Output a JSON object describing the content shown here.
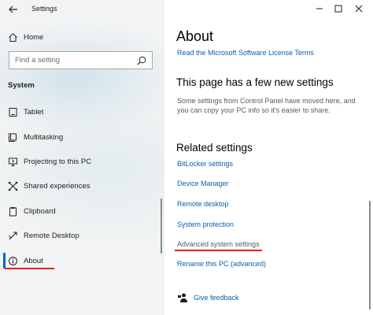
{
  "window": {
    "title": "Settings"
  },
  "sidebar": {
    "home_label": "Home",
    "search_placeholder": "Find a setting",
    "section_label": "System",
    "items": [
      {
        "label": "Tablet",
        "icon": "tablet-icon"
      },
      {
        "label": "Multitasking",
        "icon": "multitasking-icon"
      },
      {
        "label": "Projecting to this PC",
        "icon": "projecting-icon"
      },
      {
        "label": "Shared experiences",
        "icon": "shared-experiences-icon"
      },
      {
        "label": "Clipboard",
        "icon": "clipboard-icon"
      },
      {
        "label": "Remote Desktop",
        "icon": "remote-desktop-icon"
      },
      {
        "label": "About",
        "icon": "info-icon",
        "selected": true
      }
    ]
  },
  "main": {
    "title": "About",
    "license_link": "Read the Microsoft Software License Terms",
    "new_settings_heading": "This page has a few new settings",
    "new_settings_desc": "Some settings from Control Panel have moved here, and you can copy your PC info so it's easier to share.",
    "related_heading": "Related settings",
    "related_links": [
      "BitLocker settings",
      "Device Manager",
      "Remote desktop",
      "System protection",
      "Advanced system settings",
      "Rename this PC (advanced)"
    ],
    "feedback_label": "Give feedback"
  },
  "colors": {
    "accent": "#0067c0",
    "link": "#0c5fa8",
    "highlight_underline": "#e0201e"
  }
}
